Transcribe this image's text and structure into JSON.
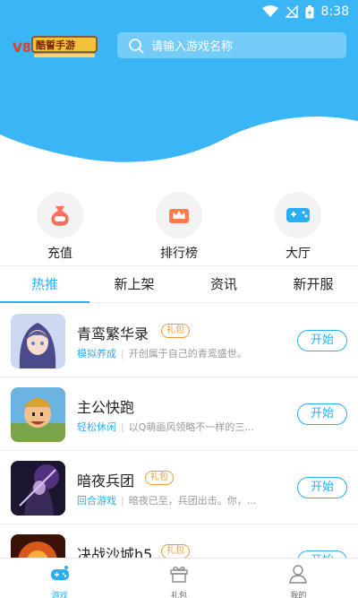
{
  "status": {
    "time": "8:38"
  },
  "logo": {
    "text": "酷誓手游"
  },
  "search": {
    "placeholder": "请输入游戏名称"
  },
  "quick_actions": [
    {
      "label": "充值"
    },
    {
      "label": "排行榜"
    },
    {
      "label": "大厅"
    }
  ],
  "tabs": [
    {
      "label": "热推"
    },
    {
      "label": "新上架"
    },
    {
      "label": "资讯"
    },
    {
      "label": "新开服"
    }
  ],
  "games": [
    {
      "name": "青鸾繁华录",
      "badge": "礼包",
      "category": "模拟养成",
      "desc": "开创属于自己的青鸾盛世。",
      "button": "开始"
    },
    {
      "name": "主公快跑",
      "badge": "",
      "category": "轻松休闲",
      "desc": "以Q萌画风领略不一样的三...",
      "button": "开始"
    },
    {
      "name": "暗夜兵团",
      "badge": "礼包",
      "category": "回合游戏",
      "desc": "暗夜已至，兵团出击。你，...",
      "button": "开始"
    },
    {
      "name": "决战沙城h5",
      "badge": "礼包",
      "category": "",
      "desc": "",
      "button": "开始"
    }
  ],
  "bottom_nav": [
    {
      "label": "游戏"
    },
    {
      "label": "礼包"
    },
    {
      "label": "我的"
    }
  ],
  "colors": {
    "accent": "#2aaef5",
    "hero": "#3ab6f7",
    "badge": "#f39a3a"
  }
}
